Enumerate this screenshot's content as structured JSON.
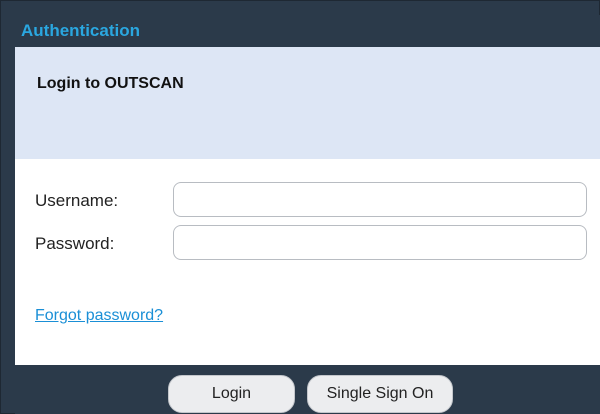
{
  "window": {
    "title": "Authentication"
  },
  "header": {
    "title": "Login to OUTSCAN"
  },
  "form": {
    "username_label": "Username:",
    "username_value": "",
    "password_label": "Password:",
    "password_value": "",
    "forgot_link": "Forgot password?"
  },
  "footer": {
    "login_label": "Login",
    "sso_label": "Single Sign On"
  },
  "colors": {
    "title_accent": "#2aa7e0",
    "frame": "#2b3a4a",
    "header_band": "#dde6f5",
    "link": "#1a8fd6"
  }
}
